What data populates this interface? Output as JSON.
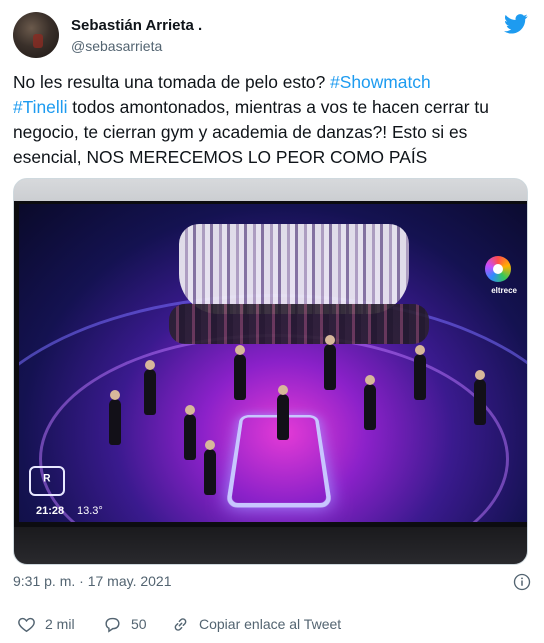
{
  "author": {
    "name": "Sebastián Arrieta .",
    "handle": "@sebasarrieta"
  },
  "tweet": {
    "text_intro": "No les resulta una tomada de pelo esto? ",
    "hashtag_1": "#Showmatch",
    "hashtag_2": "#Tinelli",
    "text_body": " todos amontonados, mientras a vos te hacen cerrar tu negocio, te cierran gym y academia de danzas?! Esto si es esencial, NOS MERECEMOS LO PEOR COMO PAÍS"
  },
  "media": {
    "channel_name": "eltrece",
    "clock": "21:28",
    "temperature": "13.3°"
  },
  "meta": {
    "timestamp": "9:31 p. m. · 17 may. 2021"
  },
  "actions": {
    "likes": "2 mil",
    "replies": "50",
    "share_label": "Copiar enlace al Tweet"
  },
  "colors": {
    "brand": "#1d9bf0",
    "text_primary": "#0f1419",
    "text_secondary": "#536471",
    "like_icon": "#536471"
  },
  "icons": {
    "platform": "twitter-bird-icon",
    "info": "info-icon",
    "like": "heart-icon",
    "reply": "reply-icon",
    "share": "link-icon"
  }
}
